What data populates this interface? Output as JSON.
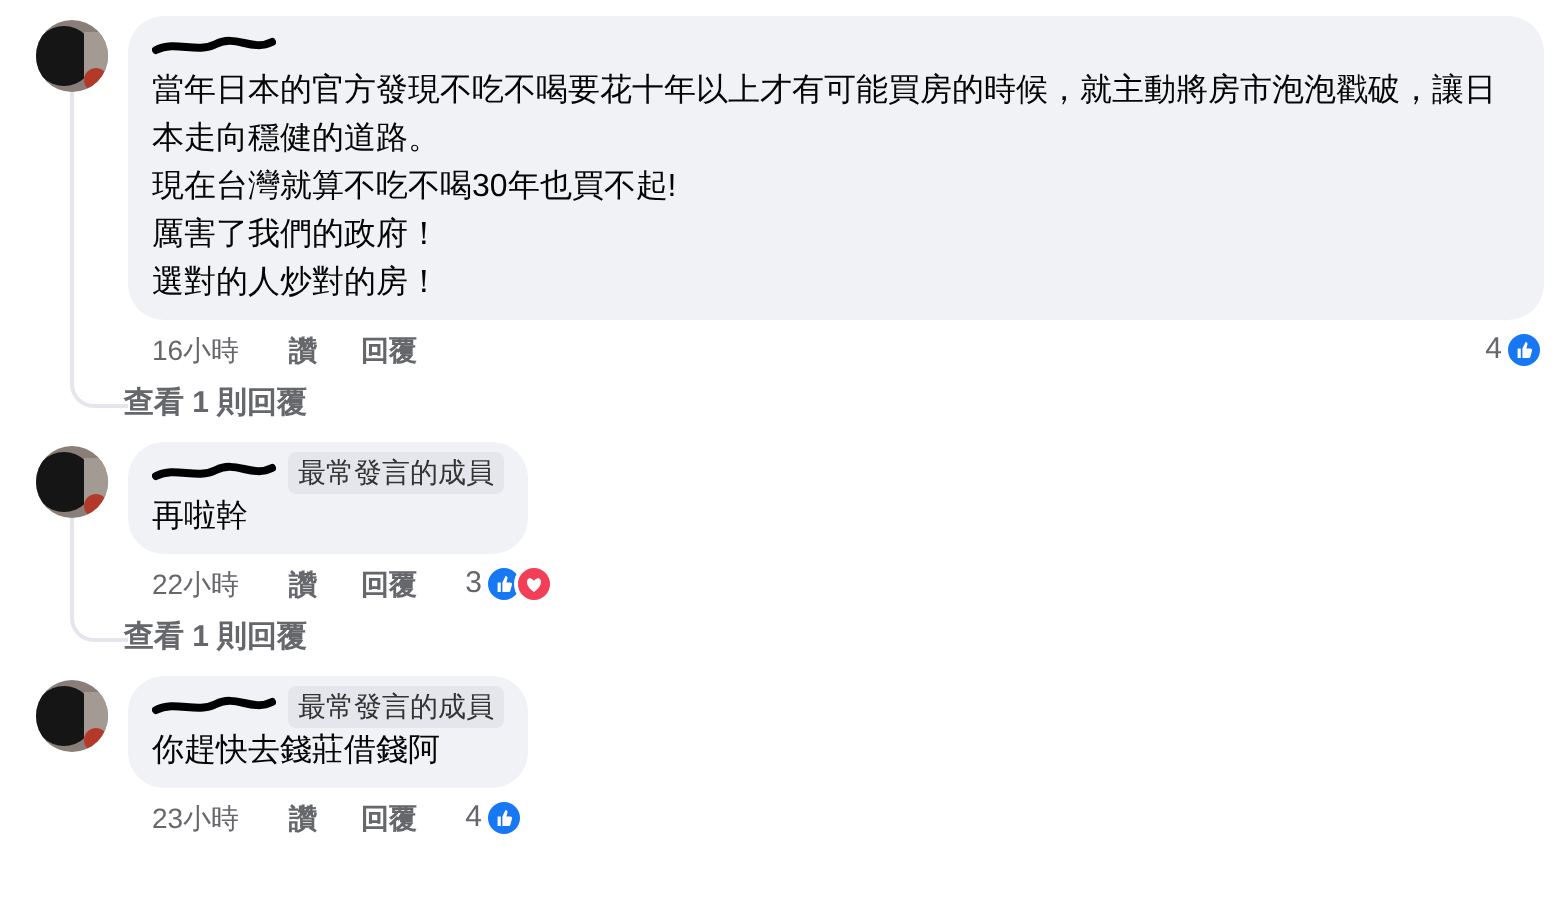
{
  "comments": [
    {
      "paragraphs": [
        "當年日本的官方發現不吃不喝要花十年以上才有可能買房的時候，就主動將房市泡泡戳破，讓日本走向穩健的道路。",
        "現在台灣就算不吃不喝30年也買不起!",
        "厲害了我們的政府！",
        "選對的人炒對的房！"
      ],
      "time": "16小時",
      "like": "讚",
      "reply": "回覆",
      "reaction_count": "4",
      "reactions": [
        {
          "kind": "like"
        }
      ],
      "view_replies": "查看 1 則回覆"
    },
    {
      "badge": "最常發言的成員",
      "paragraphs": [
        "再啦幹"
      ],
      "time": "22小時",
      "like": "讚",
      "reply": "回覆",
      "reaction_count": "3",
      "reactions": [
        {
          "kind": "like"
        },
        {
          "kind": "love"
        }
      ],
      "view_replies": "查看 1 則回覆"
    },
    {
      "badge": "最常發言的成員",
      "paragraphs": [
        "你趕快去錢莊借錢阿"
      ],
      "time": "23小時",
      "like": "讚",
      "reply": "回覆",
      "reaction_count": "4",
      "reactions": [
        {
          "kind": "like"
        }
      ]
    }
  ]
}
